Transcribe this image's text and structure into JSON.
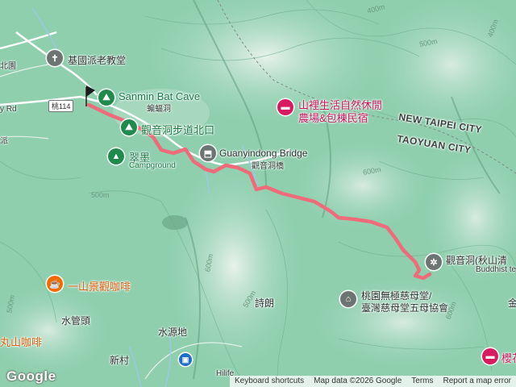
{
  "map": {
    "land_color": "#8fcfae",
    "route_color": "#f06b7a",
    "labels": {
      "church": "基國派老教堂",
      "bat_cave_en": "Sanmin Bat Cave",
      "bat_cave_zh": "蝙蝠洞",
      "trail_north": "觀音洞步道北口",
      "campground_zh": "翠墨",
      "campground_en": "Campground",
      "bridge_en": "Guanyindong Bridge",
      "bridge_zh": "觀音洞橋",
      "lodge_line1": "山裡生活自然休閒",
      "lodge_line2": "農場&包棟民宿",
      "new_taipei": "NEW TAIPEI CITY",
      "taoyuan": "TAOYUAN CITY",
      "temple_zh": "觀音洞(秋山清",
      "temple_en": "Buddhist te",
      "shrine_line1": "桃園無極慈母堂/",
      "shrine_line2": "臺灣慈母堂五母協會",
      "cafe1": "一山景觀咖啡",
      "cafe2": "丸山咖啡",
      "place1": "水管頭",
      "place2": "水源地",
      "place3": "詩朗",
      "place4": "新村",
      "place5": "金",
      "place6": "櫻花",
      "place7": "Hilife",
      "road_tag": "桃114",
      "road_left": "y Rd",
      "edge1": "北園",
      "edge2": "派"
    },
    "contours": [
      "400m",
      "500m",
      "600m",
      "500m",
      "600m",
      "500m",
      "600m",
      "500m",
      "400m"
    ],
    "icons": {
      "church": "cross-icon",
      "cave": "hiker-icon",
      "trailhead": "hiker-icon",
      "campground": "tent-icon",
      "bridge": "landmark-icon",
      "lodge": "bed-icon",
      "temple": "temple-icon",
      "shrine": "shrine-icon",
      "cafe": "coffee-icon"
    }
  },
  "footer": {
    "logo": "Google",
    "shortcuts": "Keyboard shortcuts",
    "map_data": "Map data ©2026 Google",
    "terms": "Terms",
    "report": "Report a map error"
  }
}
